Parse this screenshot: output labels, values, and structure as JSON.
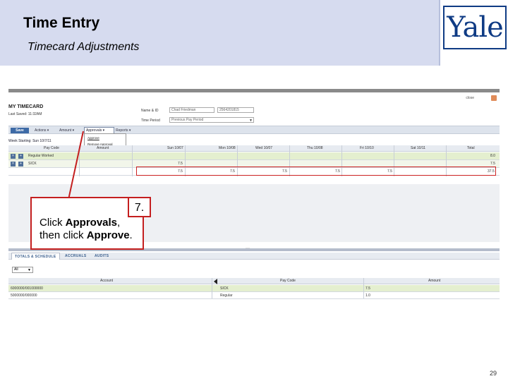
{
  "slide": {
    "title": "Time Entry",
    "subtitle": "Timecard Adjustments",
    "logo_text": "Yale",
    "page_number": "29"
  },
  "callout": {
    "step": "7.",
    "line1_prefix": "Click ",
    "line1_bold": "Approvals",
    "line1_suffix": ",",
    "line2_prefix": "then click ",
    "line2_bold": "Approve",
    "line2_suffix": "."
  },
  "timecard": {
    "title": "MY TIMECARD",
    "last_saved": "Last Saved: 11:32AM",
    "close_label": "close",
    "name_label": "Name & ID",
    "name_value": "Chad Friedman",
    "id_value": "2564201815",
    "period_label": "Time Period",
    "period_value": "Previous Pay Period",
    "week_label": "Week Starting: Sun 10/7/11"
  },
  "toolbar": {
    "save_label": "Save",
    "actions_label": "Actions ▾",
    "amount_label": "Amount ▾",
    "approvals_label": "Approvals ▾",
    "reports_label": "Reports ▾"
  },
  "approvals_menu": {
    "items": [
      "Approve",
      "Remove Approval"
    ]
  },
  "grid": {
    "columns": [
      "Pay Code",
      "Amount",
      "Sun 10/07",
      "Mon 10/08",
      "Wed 10/07",
      "Thu 10/08",
      "Fri 10/10",
      "Sat 10/11",
      "Total"
    ],
    "rows": [
      {
        "paycode": "Regular Worked",
        "cells": [
          "",
          "",
          "",
          "",
          "",
          "",
          "8.0"
        ]
      },
      {
        "paycode": "SICK",
        "cells": [
          "7.5",
          "",
          "",
          "",
          "",
          "",
          "7.5"
        ]
      },
      {
        "paycode": "",
        "cells": [
          "7.5",
          "7.5",
          "7.5",
          "7.5",
          "7.5",
          "",
          "37.5"
        ]
      }
    ]
  },
  "lower_tabs": [
    "TOTALS & SCHEDULE",
    "ACCRUALS",
    "AUDITS"
  ],
  "filter": {
    "value": "All"
  },
  "totals_table": {
    "columns": [
      "Account",
      "Pay Code",
      "Amount"
    ],
    "rows": [
      [
        "6000000/001000000",
        "SICK",
        "7.5"
      ],
      [
        "5000000/000000",
        "Regular",
        "1.0"
      ]
    ]
  }
}
